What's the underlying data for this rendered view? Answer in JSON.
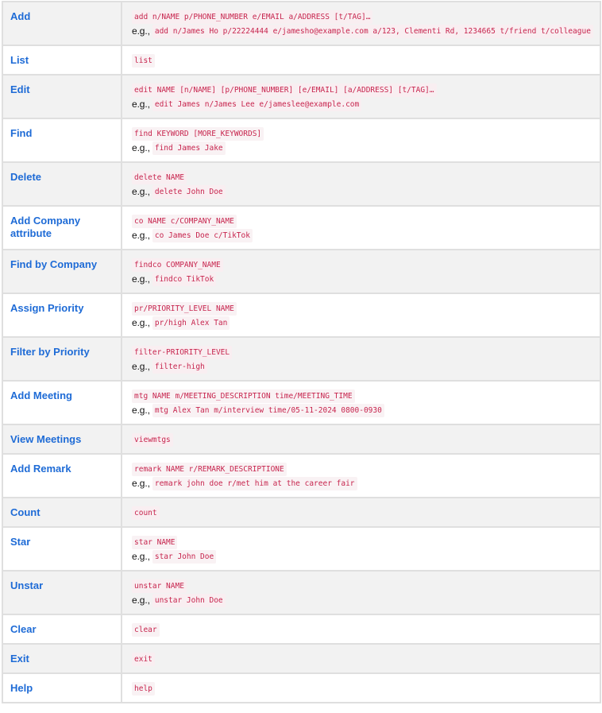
{
  "commands": [
    {
      "action": "Add",
      "format": "add n/NAME p/PHONE_NUMBER e/EMAIL a/ADDRESS [t/TAG]…",
      "example_prefix": "e.g.,",
      "example": "add n/James Ho p/22224444 e/jamesho@example.com a/123, Clementi Rd, 1234665 t/friend t/colleague"
    },
    {
      "action": "List",
      "format": "list"
    },
    {
      "action": "Edit",
      "format": "edit NAME [n/NAME] [p/PHONE_NUMBER] [e/EMAIL] [a/ADDRESS] [t/TAG]…",
      "example_prefix": "e.g.,",
      "example": "edit James n/James Lee e/jameslee@example.com"
    },
    {
      "action": "Find",
      "format": "find KEYWORD [MORE_KEYWORDS]",
      "example_prefix": "e.g.,",
      "example": "find James Jake"
    },
    {
      "action": "Delete",
      "format": "delete NAME",
      "example_prefix": "e.g.,",
      "example": "delete John Doe"
    },
    {
      "action": "Add Company attribute",
      "format": "co NAME c/COMPANY_NAME",
      "example_prefix": "e.g.,",
      "example": "co James Doe c/TikTok"
    },
    {
      "action": "Find by Company",
      "format": "findco COMPANY_NAME",
      "example_prefix": "e.g.,",
      "example": "findco TikTok"
    },
    {
      "action": "Assign Priority",
      "format": "pr/PRIORITY_LEVEL NAME",
      "example_prefix": "e.g.,",
      "example": "pr/high Alex Tan"
    },
    {
      "action": "Filter by Priority",
      "format": "filter-PRIORITY_LEVEL",
      "example_prefix": "e.g.,",
      "example": "filter-high"
    },
    {
      "action": "Add Meeting",
      "format": "mtg NAME m/MEETING_DESCRIPTION time/MEETING_TIME",
      "example_prefix": "e.g.,",
      "example": "mtg Alex Tan m/interview time/05-11-2024 0800-0930"
    },
    {
      "action": "View Meetings",
      "format": "viewmtgs"
    },
    {
      "action": "Add Remark",
      "format": "remark NAME r/REMARK_DESCRIPTIONE",
      "example_prefix": "e.g.,",
      "example": "remark john doe r/met him at the career fair"
    },
    {
      "action": "Count",
      "format": "count"
    },
    {
      "action": "Star",
      "format": "star NAME",
      "example_prefix": "e.g.,",
      "example": "star John Doe"
    },
    {
      "action": "Unstar",
      "format": "unstar NAME",
      "example_prefix": "e.g.,",
      "example": "unstar John Doe"
    },
    {
      "action": "Clear",
      "format": "clear"
    },
    {
      "action": "Exit",
      "format": "exit"
    },
    {
      "action": "Help",
      "format": "help"
    }
  ],
  "colors": {
    "action_text": "#1e6bd6",
    "code_text": "#c7254e",
    "code_bg": "#f9f2f4",
    "row_alt_bg": "#f2f2f2",
    "border": "#dfdfdf"
  }
}
